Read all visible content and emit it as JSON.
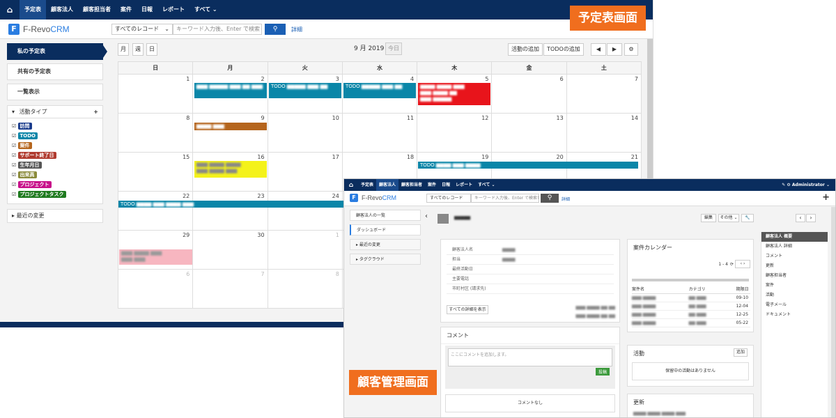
{
  "calendar_window": {
    "topnav": [
      "予定表",
      "顧客法人",
      "顧客担当者",
      "案件",
      "日報",
      "レポート",
      "すべて ⌄"
    ],
    "logo_prefix": "F-Revo",
    "logo_suffix": "CRM",
    "record_select": "すべてのレコード",
    "search_placeholder": "キーワード入力後、Enter で検索し",
    "detail_link": "詳細",
    "sidebar": {
      "my_calendar": "私の予定表",
      "shared_calendar": "共有の予定表",
      "list_view": "一覧表示",
      "activity_types_title": "活動タイプ",
      "recent_changes": "最近の変更"
    },
    "activity_types": [
      {
        "label": "訪問",
        "color": "#1a3c8c"
      },
      {
        "label": "TODO",
        "color": "#0a86a8"
      },
      {
        "label": "案件",
        "color": "#b5651d"
      },
      {
        "label": "サポート終了日",
        "color": "#b03a2e"
      },
      {
        "label": "生年月日",
        "color": "#555555"
      },
      {
        "label": "出来高",
        "color": "#8a8a3a"
      },
      {
        "label": "プロジェクト",
        "color": "#c8118a"
      },
      {
        "label": "プロジェクトタスク",
        "color": "#1e7a1e"
      }
    ],
    "view_buttons": [
      "月",
      "週",
      "日"
    ],
    "month_title": "9 月 2019",
    "today_button": "今日",
    "add_activity": "活動の追加",
    "add_todo": "TODOの追加",
    "prev": "◀",
    "next": "▶",
    "settings": "⚙",
    "weekdays": [
      "日",
      "月",
      "火",
      "水",
      "木",
      "金",
      "土"
    ],
    "weeks": [
      [
        "",
        "1",
        "2",
        "3",
        "4",
        "5",
        "6",
        "7"
      ],
      [
        "",
        "8",
        "9",
        "10",
        "11",
        "12",
        "13",
        "14"
      ],
      [
        "",
        "15",
        "16",
        "17",
        "18",
        "19",
        "20",
        "21"
      ],
      [
        "",
        "22",
        "23",
        "24",
        "",
        "",
        "",
        ""
      ],
      [
        "",
        "29",
        "30",
        "1",
        "",
        "",
        "",
        ""
      ],
      [
        "",
        "6",
        "7",
        "8",
        "",
        "",
        "",
        ""
      ]
    ],
    "events": {
      "todo": "TODO"
    }
  },
  "customer_window": {
    "topnav": [
      "予定表",
      "顧客法人",
      "顧客担当者",
      "案件",
      "日報",
      "レポート",
      "すべて ⌄"
    ],
    "admin": "Administrator ⌄",
    "record_select": "すべてのレコード",
    "search_placeholder": "キーワード入力後、Enter で検索し",
    "detail_link": "詳細",
    "left_menu": [
      "顧客法人の一覧",
      "ダッシュボード",
      "最近の変更",
      "タグクラウド"
    ],
    "buttons": {
      "edit": "編集",
      "other": "その他 ⌄",
      "prev": "‹",
      "next": "›"
    },
    "fields": [
      "顧客法人名",
      "担当",
      "最終活動日",
      "主要電話",
      "市町村区 (請求先)"
    ],
    "show_all_details": "すべての詳細を表示",
    "comment_title": "コメント",
    "comment_placeholder": "ここにコメントを追加します。",
    "post_button": "投稿",
    "no_comments": "コメントなし",
    "deal_calendar_title": "案件カレンダー",
    "pager": "1 - 4",
    "deal_columns": [
      "案件名",
      "カテゴリ",
      "期限日"
    ],
    "deal_dates": [
      "09-10",
      "12-04",
      "12-25",
      "05-22"
    ],
    "activity_title": "活動",
    "add_button": "追加",
    "no_activities": "保留中の活動はありません",
    "updates_title": "更新",
    "right_links": [
      "顧客法人 概要",
      "顧客法人 詳細",
      "コメント",
      "更新",
      "顧客担当者",
      "案件",
      "活動",
      "電子メール",
      "ドキュメント"
    ]
  },
  "callouts": {
    "calendar": "予定表画面",
    "customer": "顧客管理画面"
  }
}
